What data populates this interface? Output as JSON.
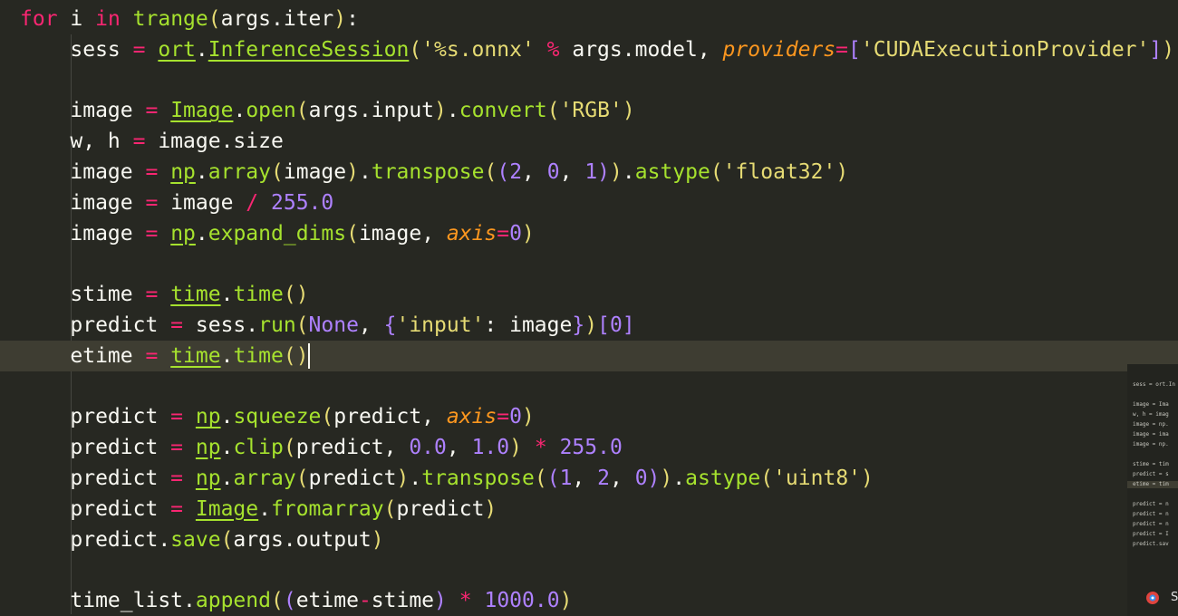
{
  "editor": {
    "theme_colors": {
      "background": "#272822",
      "keyword": "#f92672",
      "function": "#a6e22e",
      "string": "#e6db74",
      "number": "#ae81ff",
      "parameter": "#fd971f",
      "text": "#f8f8f2"
    },
    "current_line_index": 11,
    "lines": [
      [
        [
          "kw",
          "for"
        ],
        [
          "t",
          " i "
        ],
        [
          "kw",
          "in"
        ],
        [
          "t",
          " "
        ],
        [
          "fn",
          "trange"
        ],
        [
          "br1",
          "("
        ],
        [
          "t",
          "args.iter"
        ],
        [
          "br1",
          ")"
        ],
        [
          "t",
          ":"
        ]
      ],
      [
        [
          "t",
          "    sess "
        ],
        [
          "op",
          "="
        ],
        [
          "t",
          " "
        ],
        [
          "mod",
          "ort"
        ],
        [
          "t",
          "."
        ],
        [
          "mod",
          "InferenceSession"
        ],
        [
          "br1",
          "("
        ],
        [
          "str",
          "'%s.onnx'"
        ],
        [
          "t",
          " "
        ],
        [
          "op",
          "%"
        ],
        [
          "t",
          " args.model, "
        ],
        [
          "param",
          "providers"
        ],
        [
          "op",
          "="
        ],
        [
          "br2",
          "["
        ],
        [
          "str",
          "'CUDAExecutionProvider'"
        ],
        [
          "br2",
          "]"
        ],
        [
          "br1",
          ")"
        ]
      ],
      [
        [
          "t",
          ""
        ]
      ],
      [
        [
          "t",
          "    image "
        ],
        [
          "op",
          "="
        ],
        [
          "t",
          " "
        ],
        [
          "mod",
          "Image"
        ],
        [
          "t",
          "."
        ],
        [
          "fn",
          "open"
        ],
        [
          "br1",
          "("
        ],
        [
          "t",
          "args.input"
        ],
        [
          "br1",
          ")"
        ],
        [
          "t",
          "."
        ],
        [
          "fn",
          "convert"
        ],
        [
          "br1",
          "("
        ],
        [
          "str",
          "'RGB'"
        ],
        [
          "br1",
          ")"
        ]
      ],
      [
        [
          "t",
          "    w, h "
        ],
        [
          "op",
          "="
        ],
        [
          "t",
          " image.size"
        ]
      ],
      [
        [
          "t",
          "    image "
        ],
        [
          "op",
          "="
        ],
        [
          "t",
          " "
        ],
        [
          "mod",
          "np"
        ],
        [
          "t",
          "."
        ],
        [
          "fn",
          "array"
        ],
        [
          "br1",
          "("
        ],
        [
          "t",
          "image"
        ],
        [
          "br1",
          ")"
        ],
        [
          "t",
          "."
        ],
        [
          "fn",
          "transpose"
        ],
        [
          "br1",
          "("
        ],
        [
          "br2",
          "("
        ],
        [
          "num",
          "2"
        ],
        [
          "t",
          ", "
        ],
        [
          "num",
          "0"
        ],
        [
          "t",
          ", "
        ],
        [
          "num",
          "1"
        ],
        [
          "br2",
          ")"
        ],
        [
          "br1",
          ")"
        ],
        [
          "t",
          "."
        ],
        [
          "fn",
          "astype"
        ],
        [
          "br1",
          "("
        ],
        [
          "str",
          "'float32'"
        ],
        [
          "br1",
          ")"
        ]
      ],
      [
        [
          "t",
          "    image "
        ],
        [
          "op",
          "="
        ],
        [
          "t",
          " image "
        ],
        [
          "op",
          "/"
        ],
        [
          "t",
          " "
        ],
        [
          "num",
          "255.0"
        ]
      ],
      [
        [
          "t",
          "    image "
        ],
        [
          "op",
          "="
        ],
        [
          "t",
          " "
        ],
        [
          "mod",
          "np"
        ],
        [
          "t",
          "."
        ],
        [
          "fn",
          "expand_dims"
        ],
        [
          "br1",
          "("
        ],
        [
          "t",
          "image, "
        ],
        [
          "param",
          "axis"
        ],
        [
          "op",
          "="
        ],
        [
          "num",
          "0"
        ],
        [
          "br1",
          ")"
        ]
      ],
      [
        [
          "t",
          ""
        ]
      ],
      [
        [
          "t",
          "    stime "
        ],
        [
          "op",
          "="
        ],
        [
          "t",
          " "
        ],
        [
          "mod",
          "time"
        ],
        [
          "t",
          "."
        ],
        [
          "fn",
          "time"
        ],
        [
          "br1",
          "()"
        ]
      ],
      [
        [
          "t",
          "    predict "
        ],
        [
          "op",
          "="
        ],
        [
          "t",
          " sess."
        ],
        [
          "fn",
          "run"
        ],
        [
          "br1",
          "("
        ],
        [
          "num",
          "None"
        ],
        [
          "t",
          ", "
        ],
        [
          "br2",
          "{"
        ],
        [
          "str",
          "'input'"
        ],
        [
          "t",
          ": image"
        ],
        [
          "br2",
          "}"
        ],
        [
          "br1",
          ")"
        ],
        [
          "br2",
          "["
        ],
        [
          "num",
          "0"
        ],
        [
          "br2",
          "]"
        ]
      ],
      [
        [
          "t",
          "    etime "
        ],
        [
          "op",
          "="
        ],
        [
          "t",
          " "
        ],
        [
          "mod",
          "time"
        ],
        [
          "t",
          "."
        ],
        [
          "fn",
          "time"
        ],
        [
          "br1",
          "()"
        ],
        [
          "cursor",
          ""
        ]
      ],
      [
        [
          "t",
          ""
        ]
      ],
      [
        [
          "t",
          "    predict "
        ],
        [
          "op",
          "="
        ],
        [
          "t",
          " "
        ],
        [
          "mod",
          "np"
        ],
        [
          "t",
          "."
        ],
        [
          "fn",
          "squeeze"
        ],
        [
          "br1",
          "("
        ],
        [
          "t",
          "predict, "
        ],
        [
          "param",
          "axis"
        ],
        [
          "op",
          "="
        ],
        [
          "num",
          "0"
        ],
        [
          "br1",
          ")"
        ]
      ],
      [
        [
          "t",
          "    predict "
        ],
        [
          "op",
          "="
        ],
        [
          "t",
          " "
        ],
        [
          "mod",
          "np"
        ],
        [
          "t",
          "."
        ],
        [
          "fn",
          "clip"
        ],
        [
          "br1",
          "("
        ],
        [
          "t",
          "predict, "
        ],
        [
          "num",
          "0.0"
        ],
        [
          "t",
          ", "
        ],
        [
          "num",
          "1.0"
        ],
        [
          "br1",
          ")"
        ],
        [
          "t",
          " "
        ],
        [
          "op",
          "*"
        ],
        [
          "t",
          " "
        ],
        [
          "num",
          "255.0"
        ]
      ],
      [
        [
          "t",
          "    predict "
        ],
        [
          "op",
          "="
        ],
        [
          "t",
          " "
        ],
        [
          "mod",
          "np"
        ],
        [
          "t",
          "."
        ],
        [
          "fn",
          "array"
        ],
        [
          "br1",
          "("
        ],
        [
          "t",
          "predict"
        ],
        [
          "br1",
          ")"
        ],
        [
          "t",
          "."
        ],
        [
          "fn",
          "transpose"
        ],
        [
          "br1",
          "("
        ],
        [
          "br2",
          "("
        ],
        [
          "num",
          "1"
        ],
        [
          "t",
          ", "
        ],
        [
          "num",
          "2"
        ],
        [
          "t",
          ", "
        ],
        [
          "num",
          "0"
        ],
        [
          "br2",
          ")"
        ],
        [
          "br1",
          ")"
        ],
        [
          "t",
          "."
        ],
        [
          "fn",
          "astype"
        ],
        [
          "br1",
          "("
        ],
        [
          "str",
          "'uint8'"
        ],
        [
          "br1",
          ")"
        ]
      ],
      [
        [
          "t",
          "    predict "
        ],
        [
          "op",
          "="
        ],
        [
          "t",
          " "
        ],
        [
          "mod",
          "Image"
        ],
        [
          "t",
          "."
        ],
        [
          "fn",
          "fromarray"
        ],
        [
          "br1",
          "("
        ],
        [
          "t",
          "predict"
        ],
        [
          "br1",
          ")"
        ]
      ],
      [
        [
          "t",
          "    predict."
        ],
        [
          "fn",
          "save"
        ],
        [
          "br1",
          "("
        ],
        [
          "t",
          "args.output"
        ],
        [
          "br1",
          ")"
        ]
      ],
      [
        [
          "t",
          ""
        ]
      ],
      [
        [
          "t",
          "    time_list."
        ],
        [
          "fn",
          "append"
        ],
        [
          "br1",
          "("
        ],
        [
          "br2",
          "("
        ],
        [
          "t",
          "etime"
        ],
        [
          "op",
          "-"
        ],
        [
          "t",
          "stime"
        ],
        [
          "br2",
          ")"
        ],
        [
          "t",
          " "
        ],
        [
          "op",
          "*"
        ],
        [
          "t",
          " "
        ],
        [
          "num",
          "1000.0"
        ],
        [
          "br1",
          ")"
        ]
      ]
    ]
  },
  "minimap": {
    "lines": [
      "sess = ort.In",
      "",
      "image = Ima",
      "w, h = imag",
      "image = np.",
      "image = ima",
      "image = np.",
      "",
      "stime = tim",
      "predict = s",
      "etime = tim",
      "",
      "predict = n",
      "predict = n",
      "predict = n",
      "predict = I",
      "predict.sav"
    ],
    "highlight_index": 10,
    "trailing_label": "S"
  }
}
